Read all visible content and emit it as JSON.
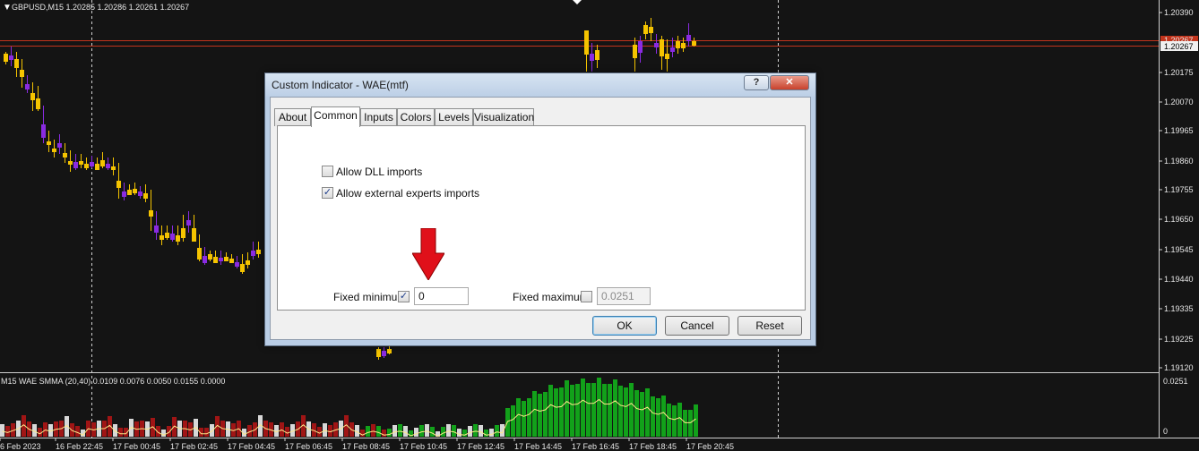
{
  "chart": {
    "header": "GBPUSD,M15  1.20285 1.20286 1.20261 1.20267",
    "price_labels": [
      "1.20390",
      "1.20175",
      "1.20070",
      "1.19965",
      "1.19860",
      "1.19755",
      "1.19650",
      "1.19545",
      "1.19440",
      "1.19335",
      "1.19225",
      "1.19120"
    ],
    "current_price_red": "1.20267",
    "current_price_white": "1.20267",
    "indicator_header": "M15  WAE  SMMA (20,40) 0.0109 0.0076 0.0050 0.0155 0.0000",
    "indicator_scale_top": "0.0251",
    "indicator_scale_bottom": "0",
    "time_labels": [
      "6 Feb 2023",
      "16 Feb 22:45",
      "17 Feb 00:45",
      "17 Feb 02:45",
      "17 Feb 04:45",
      "17 Feb 06:45",
      "17 Feb 08:45",
      "17 Feb 10:45",
      "17 Feb 12:45",
      "17 Feb 14:45",
      "17 Feb 16:45",
      "17 Feb 18:45",
      "17 Feb 20:45"
    ],
    "colors": {
      "bull": "#f5c400",
      "bear": "#8a2be2",
      "hist_green": "#12a11a",
      "hist_red": "#a01515",
      "hist_white": "#d8d8d8",
      "signal": "#ffe98a",
      "price_line": "#c2341c"
    }
  },
  "dialog": {
    "title": "Custom Indicator - WAE(mtf)",
    "help_label": "?",
    "close_label": "✕",
    "tabs": [
      "About",
      "Common",
      "Inputs",
      "Colors",
      "Levels",
      "Visualization"
    ],
    "active_tab": "Common",
    "allow_dll_label": "Allow DLL imports",
    "allow_dll_checked": false,
    "allow_experts_label": "Allow external experts imports",
    "allow_experts_checked": true,
    "fixed_min_label": "Fixed minimum",
    "fixed_min_checked": true,
    "fixed_min_value": "0",
    "fixed_max_label": "Fixed maximum",
    "fixed_max_checked": false,
    "fixed_max_value": "0.0251",
    "ok_label": "OK",
    "cancel_label": "Cancel",
    "reset_label": "Reset"
  }
}
